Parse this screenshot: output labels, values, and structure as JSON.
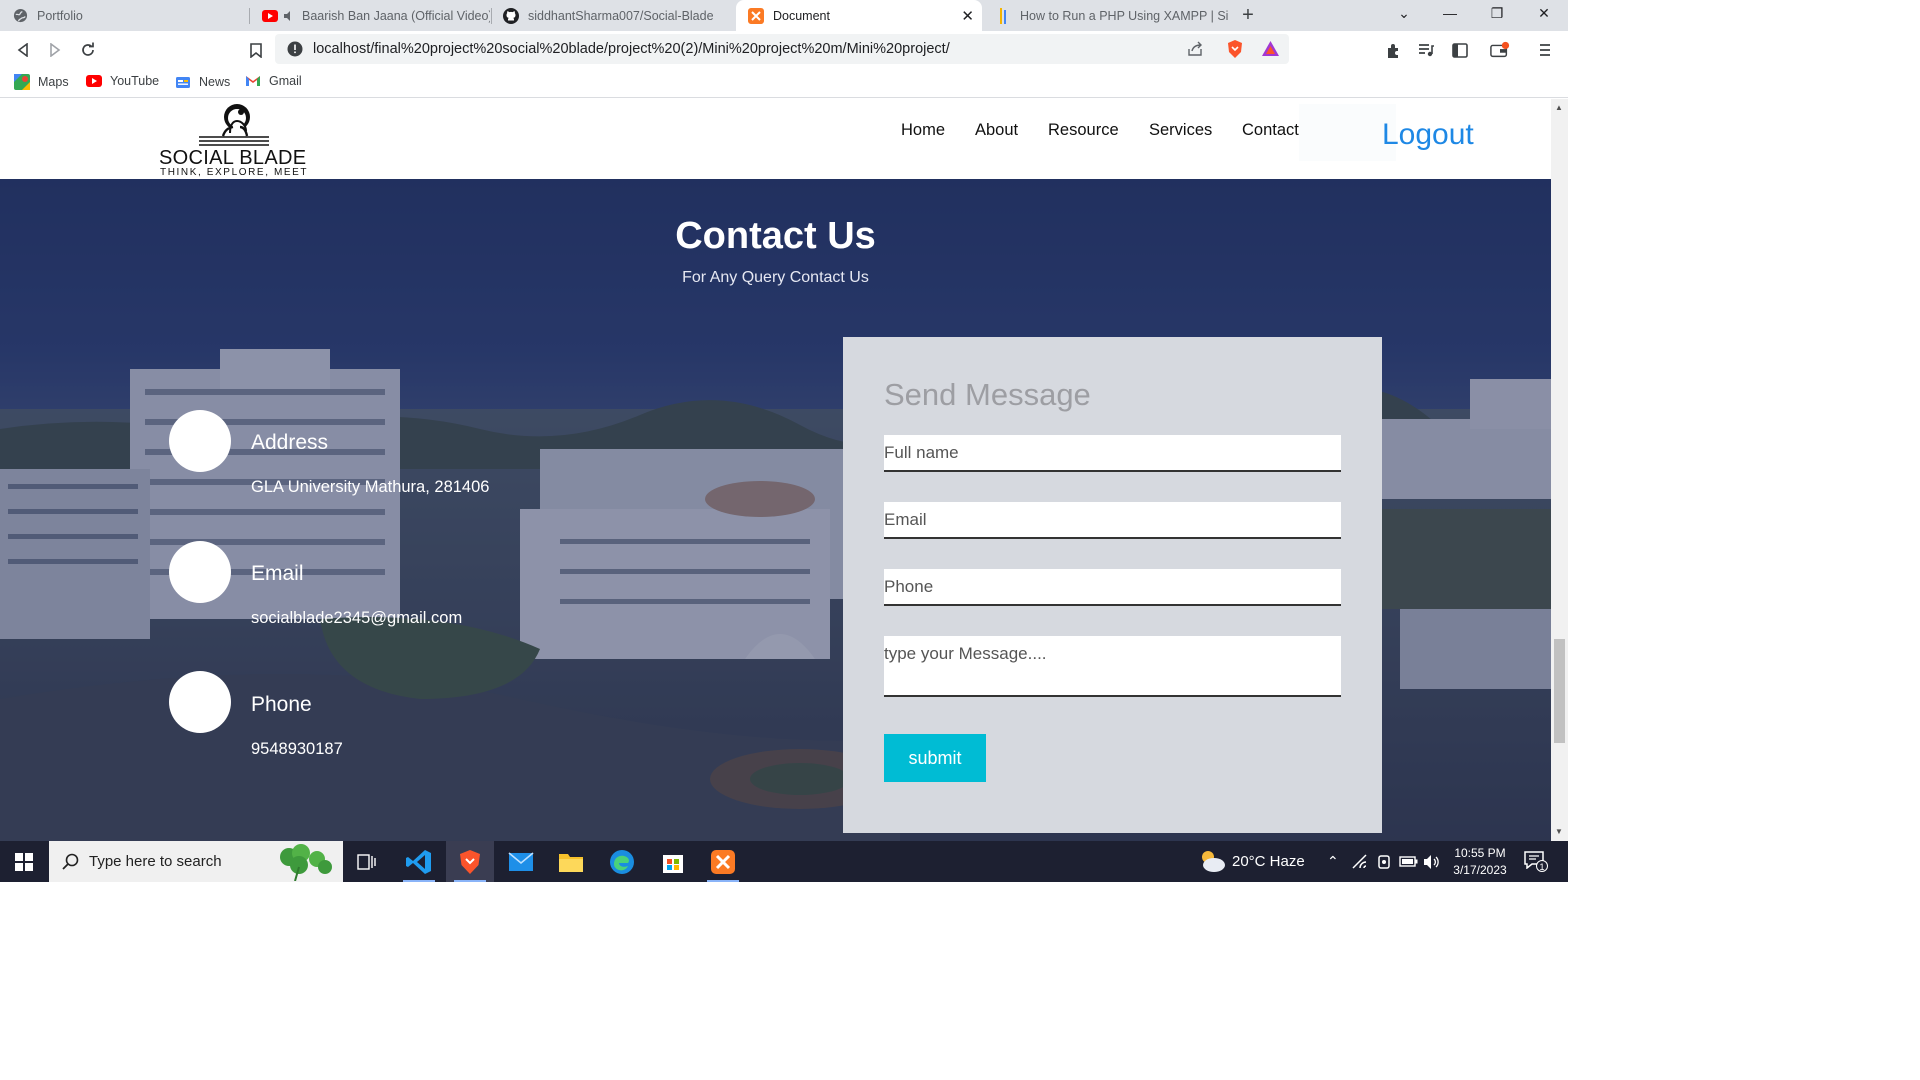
{
  "browser": {
    "tabs": [
      {
        "title": "Portfolio",
        "active": false
      },
      {
        "title": "Baarish Ban Jaana (Official Video) |",
        "active": false
      },
      {
        "title": "siddhantSharma007/Social-Blade",
        "active": false
      },
      {
        "title": "Document",
        "active": true
      },
      {
        "title": "How to Run a PHP Using XAMPP | Sim",
        "active": false
      }
    ],
    "url": "localhost/final%20project%20social%20blade/project%20(2)/Mini%20project%20m/Mini%20project/",
    "bookmarks": [
      {
        "label": "Maps"
      },
      {
        "label": "YouTube"
      },
      {
        "label": "News"
      },
      {
        "label": "Gmail"
      }
    ]
  },
  "site": {
    "logo": {
      "brand": "SOCIAL BLADE",
      "tagline": "THINK, EXPLORE, MEET"
    },
    "nav": [
      "Home",
      "About",
      "Resource",
      "Services",
      "Contact"
    ],
    "logout_label": "Logout"
  },
  "contact": {
    "title": "Contact Us",
    "subtitle": "For Any Query Contact Us",
    "info": [
      {
        "label": "Address",
        "value": "GLA University Mathura, 281406"
      },
      {
        "label": "Email",
        "value": "socialblade2345@gmail.com"
      },
      {
        "label": "Phone",
        "value": "9548930187"
      }
    ],
    "form": {
      "title": "Send Message",
      "fullname_placeholder": "Full name",
      "email_placeholder": "Email",
      "phone_placeholder": "Phone",
      "message_placeholder": "type your Message....",
      "submit_label": "submit"
    }
  },
  "taskbar": {
    "search_placeholder": "Type here to search",
    "weather": "20°C  Haze",
    "time": "10:55 PM",
    "date": "3/17/2023",
    "notification_count": "1"
  },
  "colors": {
    "accent": "#00bcd4",
    "logout": "#1e88e5",
    "overlay": "#16204e",
    "form_bg": "#d6d9df"
  }
}
